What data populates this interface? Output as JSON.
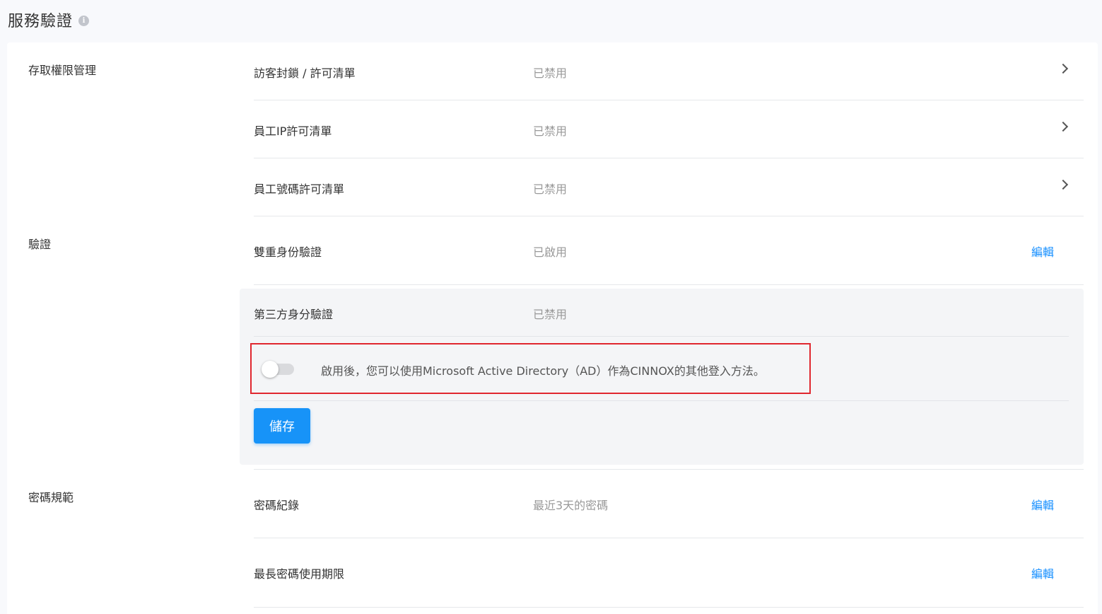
{
  "header": {
    "title": "服務驗證",
    "info_icon": "i"
  },
  "sections": {
    "access": {
      "label": "存取權限管理",
      "rows": [
        {
          "name": "訪客封鎖 / 許可清單",
          "value": "已禁用"
        },
        {
          "name": "員工IP許可清單",
          "value": "已禁用"
        },
        {
          "name": "員工號碼許可清單",
          "value": "已禁用"
        }
      ]
    },
    "auth": {
      "label": "驗證",
      "two_factor": {
        "name": "雙重身份驗證",
        "value": "已啟用",
        "action": "編輯"
      },
      "third_party": {
        "name": "第三方身分驗證",
        "value": "已禁用",
        "toggle_on": false,
        "toggle_description": "啟用後，您可以使用Microsoft Active Directory（AD）作為CINNOX的其他登入方法。",
        "save_label": "儲存"
      }
    },
    "password": {
      "label": "密碼規範",
      "rows": [
        {
          "name": "密碼紀錄",
          "value": "最近3天的密碼",
          "action": "編輯"
        },
        {
          "name": "最長密碼使用期限",
          "value": "",
          "action": "編輯"
        }
      ]
    }
  },
  "colors": {
    "accent": "#1890ff",
    "button": "#1793f8",
    "highlight_border": "#e0272f"
  }
}
